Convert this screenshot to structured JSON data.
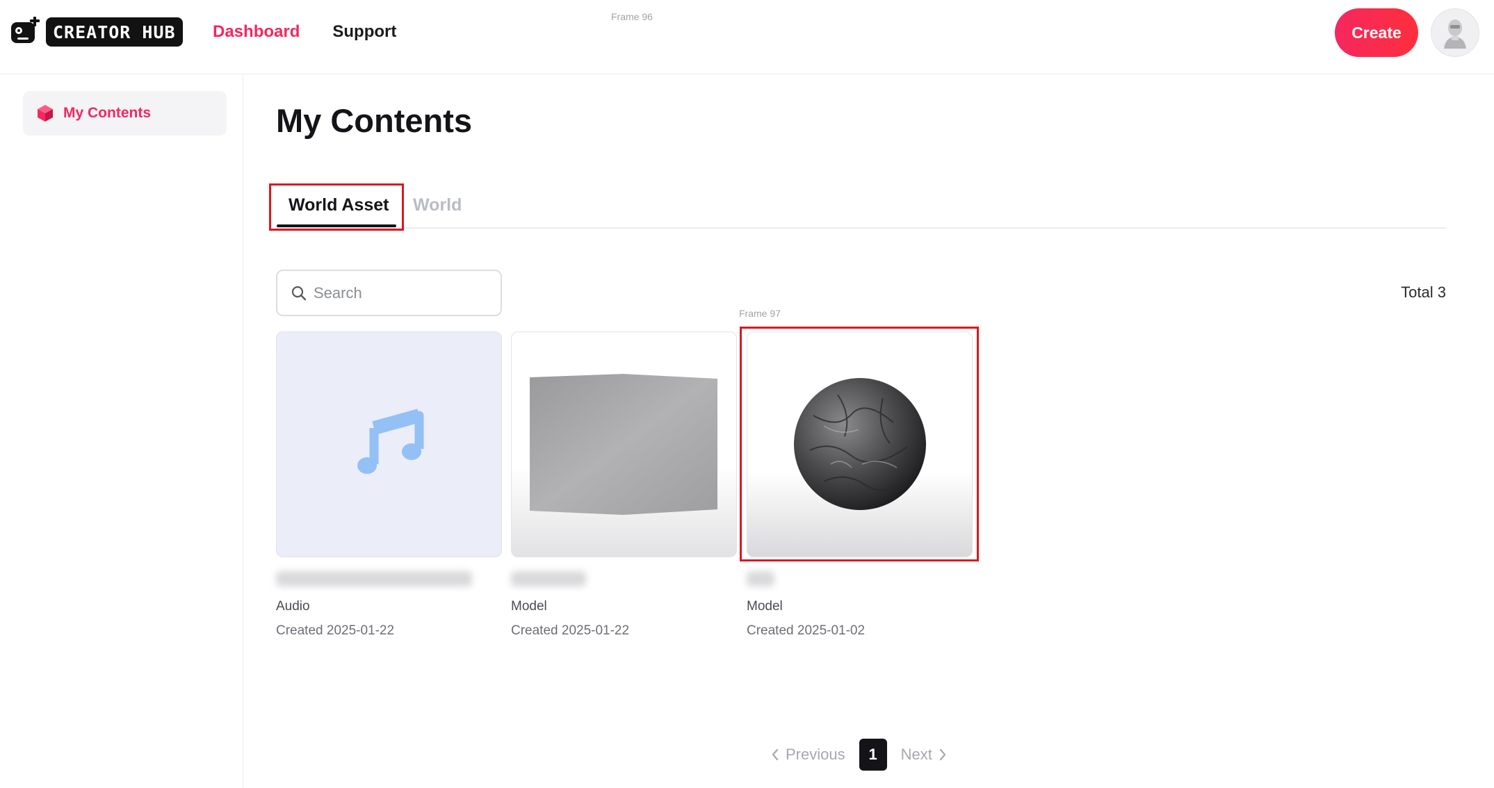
{
  "header": {
    "logo_text": "CREATOR HUB",
    "nav": [
      {
        "label": "Dashboard",
        "active": true
      },
      {
        "label": "Support",
        "active": false
      }
    ],
    "frame_label": "Frame 96",
    "create_label": "Create"
  },
  "sidebar": {
    "items": [
      {
        "label": "My Contents",
        "icon": "cube-icon",
        "active": true
      }
    ]
  },
  "main": {
    "title": "My Contents",
    "tabs": [
      {
        "label": "World Asset",
        "active": true
      },
      {
        "label": "World",
        "active": false
      }
    ],
    "search": {
      "placeholder": "Search"
    },
    "total": "Total 3",
    "frame_label": "Frame 97",
    "cards": [
      {
        "type": "Audio",
        "created": "Created 2025-01-22",
        "thumb": "music-note-icon"
      },
      {
        "type": "Model",
        "created": "Created 2025-01-22",
        "thumb": "gray-cube"
      },
      {
        "type": "Model",
        "created": "Created 2025-01-02",
        "thumb": "rock-sphere"
      }
    ]
  },
  "pagination": {
    "previous": "Previous",
    "current": "1",
    "next": "Next"
  },
  "colors": {
    "accent": "#f5275f",
    "highlight_box": "#e0151d",
    "dark": "#141418"
  }
}
